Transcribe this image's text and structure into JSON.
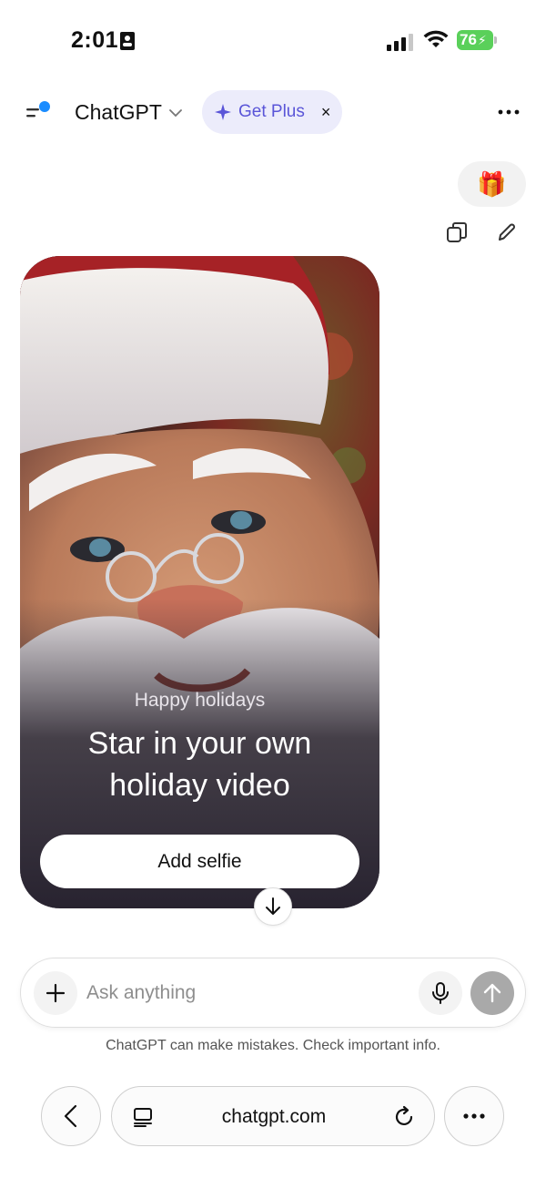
{
  "status_bar": {
    "time": "2:01",
    "battery": "76"
  },
  "header": {
    "app_title": "ChatGPT",
    "get_plus_label": "Get Plus",
    "get_plus_close": "×"
  },
  "user_message": {
    "emoji": "🎁"
  },
  "promo_card": {
    "eyebrow": "Happy holidays",
    "title_line1": "Star in your own",
    "title_line2": "holiday video",
    "button_label": "Add selfie"
  },
  "composer": {
    "placeholder": "Ask anything"
  },
  "disclaimer": "ChatGPT can make mistakes. Check important info.",
  "browser": {
    "url": "chatgpt.com"
  },
  "colors": {
    "accent": "#5a55d8",
    "notification_dot": "#1a8cff",
    "battery": "#5ad05a",
    "send_disabled": "#a9a9a9"
  },
  "icons": {
    "sidebar": "sidebar-menu-icon",
    "more": "ellipsis-icon",
    "copy": "copy-icon",
    "edit": "pencil-icon",
    "plus": "plus-icon",
    "mic": "microphone-icon",
    "send": "arrow-up-icon",
    "back": "chevron-left-icon",
    "tabs": "tabs-icon",
    "reload": "reload-icon",
    "scroll": "arrow-down-icon"
  }
}
